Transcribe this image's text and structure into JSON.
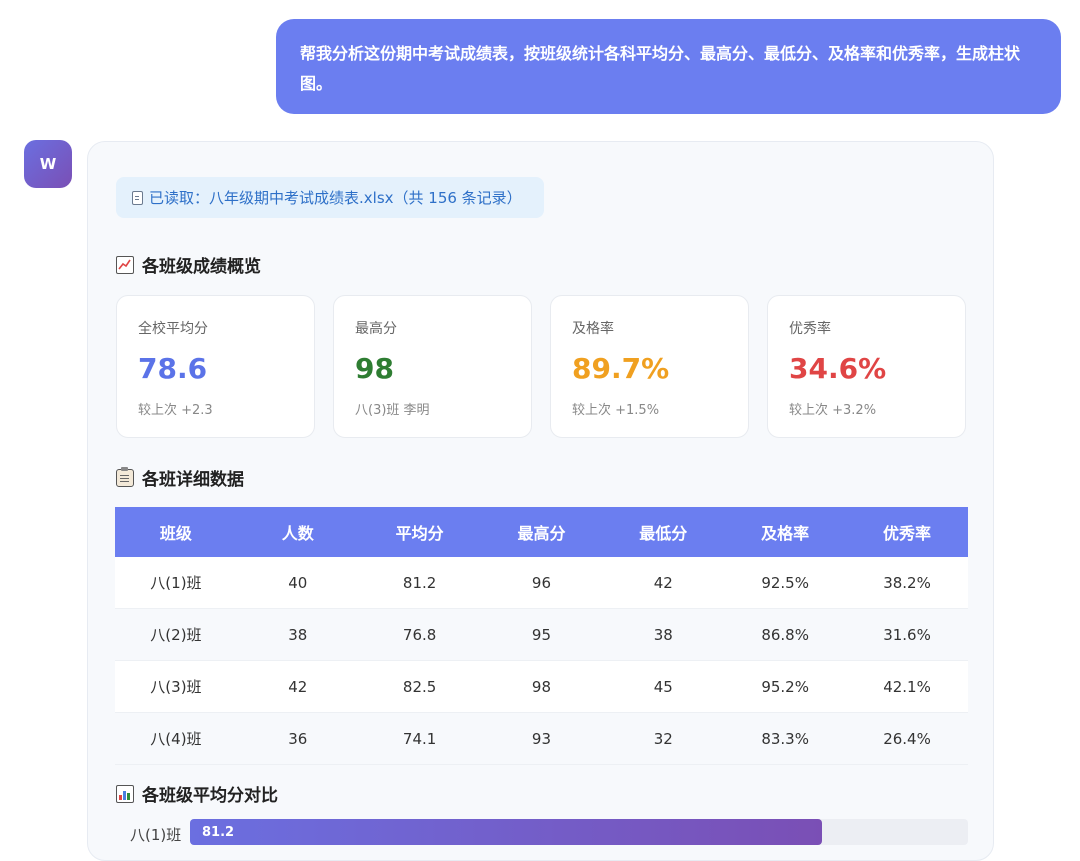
{
  "user_message": "帮我分析这份期中考试成绩表，按班级统计各科平均分、最高分、最低分、及格率和优秀率，生成柱状图。",
  "assistant": {
    "avatar_letter": "W",
    "file_notice": "已读取：八年级期中考试成绩表.xlsx（共 156 条记录）",
    "overview_title": "各班级成绩概览",
    "stats": [
      {
        "label": "全校平均分",
        "value": "78.6",
        "sub": "较上次 +2.3",
        "color": "#5b73e8"
      },
      {
        "label": "最高分",
        "value": "98",
        "sub": "八(3)班 李明",
        "color": "#2e7d32"
      },
      {
        "label": "及格率",
        "value": "89.7%",
        "sub": "较上次 +1.5%",
        "color": "#f0a020"
      },
      {
        "label": "优秀率",
        "value": "34.6%",
        "sub": "较上次 +3.2%",
        "color": "#e04545"
      }
    ],
    "detail_title": "各班详细数据",
    "table": {
      "headers": [
        "班级",
        "人数",
        "平均分",
        "最高分",
        "最低分",
        "及格率",
        "优秀率"
      ],
      "rows": [
        [
          "八(1)班",
          "40",
          "81.2",
          "96",
          "42",
          "92.5%",
          "38.2%"
        ],
        [
          "八(2)班",
          "38",
          "76.8",
          "95",
          "38",
          "86.8%",
          "31.6%"
        ],
        [
          "八(3)班",
          "42",
          "82.5",
          "98",
          "45",
          "95.2%",
          "42.1%"
        ],
        [
          "八(4)班",
          "36",
          "74.1",
          "93",
          "32",
          "83.3%",
          "26.4%"
        ]
      ]
    },
    "chart_title": "各班级平均分对比",
    "chart_data": {
      "type": "bar",
      "categories": [
        "八(1)班"
      ],
      "values": [
        81.2
      ]
    }
  }
}
